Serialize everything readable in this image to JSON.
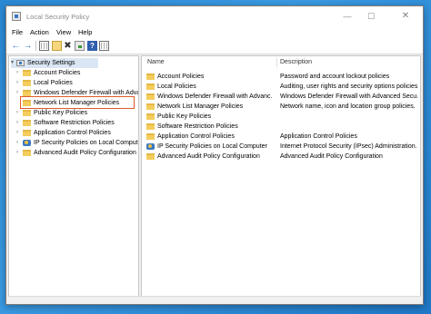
{
  "window": {
    "title": "Local Security Policy"
  },
  "window_controls": {
    "minimize": "—",
    "maximize": "☐",
    "close": "✕"
  },
  "menu": [
    "File",
    "Action",
    "View",
    "Help"
  ],
  "tree": {
    "root": "Security Settings",
    "items": [
      {
        "label": "Account Policies",
        "icon": "folder-icon"
      },
      {
        "label": "Local Policies",
        "icon": "folder-icon"
      },
      {
        "label": "Windows Defender Firewall with Advanc",
        "icon": "folder-icon"
      },
      {
        "label": "Network List Manager Policies",
        "icon": "folder-icon"
      },
      {
        "label": "Public Key Policies",
        "icon": "folder-icon"
      },
      {
        "label": "Software Restriction Policies",
        "icon": "folder-icon"
      },
      {
        "label": "Application Control Policies",
        "icon": "folder-icon"
      },
      {
        "label": "IP Security Policies on Local Computer",
        "icon": "ipsec-icon"
      },
      {
        "label": "Advanced Audit Policy Configuration",
        "icon": "folder-icon"
      }
    ]
  },
  "list": {
    "columns": [
      "Name",
      "Description"
    ],
    "rows": [
      {
        "name": "Account Policies",
        "desc": "Password and account lockout policies"
      },
      {
        "name": "Local Policies",
        "desc": "Auditing, user rights and security options policies"
      },
      {
        "name": "Windows Defender Firewall with Advanc...",
        "desc": "Windows Defender Firewall with Advanced Secu..."
      },
      {
        "name": "Network List Manager Policies",
        "desc": "Network name, icon and location group policies."
      },
      {
        "name": "Public Key Policies",
        "desc": ""
      },
      {
        "name": "Software Restriction Policies",
        "desc": ""
      },
      {
        "name": "Application Control Policies",
        "desc": "Application Control Policies"
      },
      {
        "name": "IP Security Policies on Local Computer",
        "desc": "Internet Protocol Security (IPsec) Administration. ..."
      },
      {
        "name": "Advanced Audit Policy Configuration",
        "desc": "Advanced Audit Policy Configuration"
      }
    ]
  },
  "colors": {
    "highlight_border": "#e05a2a",
    "selection": "#dbe6f4",
    "folder": "#f3cd5d"
  }
}
